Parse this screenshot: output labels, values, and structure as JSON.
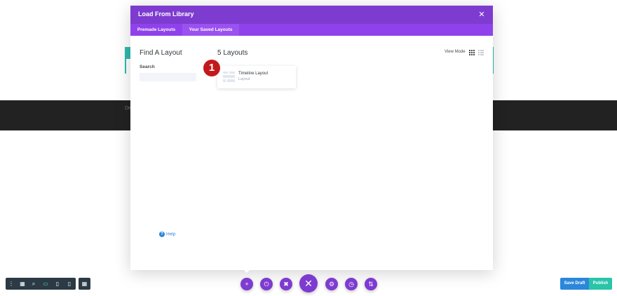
{
  "background": {
    "dark_band_text": "De"
  },
  "modal": {
    "title": "Load From Library",
    "close_icon": "close-icon",
    "tabs": [
      {
        "label": "Premade Layouts",
        "active": false
      },
      {
        "label": "Your Saved Layouts",
        "active": true
      }
    ],
    "sidebar": {
      "heading": "Find A Layout",
      "search_label": "Search",
      "search_value": "",
      "help_label": "Help"
    },
    "main": {
      "count_heading": "5 Layouts",
      "view_mode_label": "View Mode",
      "view_modes": [
        {
          "icon": "grid-view-icon",
          "active": true
        },
        {
          "icon": "list-view-icon",
          "active": false
        }
      ],
      "layouts": [
        {
          "name": "Timeline Layout",
          "type": "Layout"
        }
      ]
    },
    "step_badge": "1"
  },
  "toolbar_left": {
    "icons": [
      "more-options-icon",
      "wireframe-icon",
      "zoom-icon",
      "desktop-view-icon",
      "tablet-view-icon",
      "phone-view-icon"
    ],
    "active_icon": "desktop-view-icon",
    "grid_toggle_icon": "grid-icon"
  },
  "toolbar_center": {
    "buttons": [
      "add-icon",
      "power-icon",
      "trash-icon",
      "close-icon",
      "settings-icon",
      "history-icon",
      "sort-icon"
    ]
  },
  "toolbar_right": {
    "save_draft_label": "Save Draft",
    "publish_label": "Publish"
  },
  "colors": {
    "accent_purple": "#7e3bd0",
    "tab_bar_purple": "#8f42ec",
    "badge_red": "#c3191c",
    "save_blue": "#2b87da",
    "publish_teal": "#29c4a9",
    "dark_toolbar": "#2b3a44"
  }
}
